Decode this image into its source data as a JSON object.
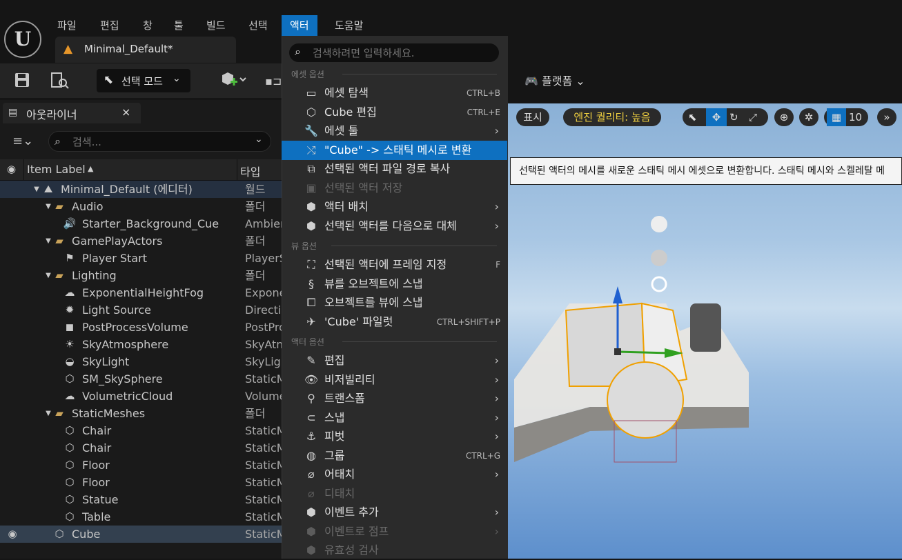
{
  "menubar": {
    "items": [
      "파일",
      "편집",
      "창",
      "툴",
      "빌드",
      "선택",
      "액터",
      "도움말"
    ],
    "active": "액터"
  },
  "logo_icon": "unreal-logo",
  "doc_tab": {
    "title": "Minimal_Default*"
  },
  "toolbar": {
    "mode_label": "선택 모드",
    "platform_label": "플랫폼"
  },
  "outliner": {
    "tab_title": "아웃라이너",
    "search_placeholder": "검색...",
    "col_label": "Item Label",
    "col_type": "타입",
    "rows": [
      {
        "label": "Minimal_Default (에디터)",
        "type": "월드",
        "icon": "world-icon",
        "indent": 1
      },
      {
        "label": "Audio",
        "type": "폴더",
        "icon": "folder-icon",
        "indent": 2
      },
      {
        "label": "Starter_Background_Cue",
        "type": "Ambien",
        "icon": "speaker-icon",
        "indent": 3
      },
      {
        "label": "GamePlayActors",
        "type": "폴더",
        "icon": "folder-icon",
        "indent": 2
      },
      {
        "label": "Player Start",
        "type": "PlayerS",
        "icon": "player-start-icon",
        "indent": 3
      },
      {
        "label": "Lighting",
        "type": "폴더",
        "icon": "folder-icon",
        "indent": 2
      },
      {
        "label": "ExponentialHeightFog",
        "type": "Expone",
        "icon": "fog-icon",
        "indent": 3
      },
      {
        "label": "Light Source",
        "type": "Directio",
        "icon": "light-icon",
        "indent": 3
      },
      {
        "label": "PostProcessVolume",
        "type": "PostPro",
        "icon": "volume-icon",
        "indent": 3
      },
      {
        "label": "SkyAtmosphere",
        "type": "SkyAtm",
        "icon": "atmosphere-icon",
        "indent": 3
      },
      {
        "label": "SkyLight",
        "type": "SkyLig",
        "icon": "skylight-icon",
        "indent": 3
      },
      {
        "label": "SM_SkySphere",
        "type": "StaticM",
        "icon": "mesh-icon",
        "indent": 3
      },
      {
        "label": "VolumetricCloud",
        "type": "Volume",
        "icon": "cloud-icon",
        "indent": 3
      },
      {
        "label": "StaticMeshes",
        "type": "폴더",
        "icon": "folder-icon",
        "indent": 2
      },
      {
        "label": "Chair",
        "type": "StaticM",
        "icon": "mesh-icon",
        "indent": 3
      },
      {
        "label": "Chair",
        "type": "StaticM",
        "icon": "mesh-icon",
        "indent": 3
      },
      {
        "label": "Floor",
        "type": "StaticM",
        "icon": "mesh-icon",
        "indent": 3
      },
      {
        "label": "Floor",
        "type": "StaticM",
        "icon": "mesh-icon",
        "indent": 3
      },
      {
        "label": "Statue",
        "type": "StaticM",
        "icon": "mesh-icon",
        "indent": 3
      },
      {
        "label": "Table",
        "type": "StaticM",
        "icon": "mesh-icon",
        "indent": 3
      },
      {
        "label": "Cube",
        "type": "StaticM",
        "icon": "mesh-icon",
        "indent": 2
      }
    ]
  },
  "dropdown": {
    "search_placeholder": "검색하려면 입력하세요.",
    "sections": {
      "asset": "에셋 옵션",
      "view": "뷰 옵션",
      "actor": "액터 옵션"
    },
    "items": [
      {
        "label": "에셋 탐색",
        "shortcut": "CTRL+B",
        "icon": "browse-icon"
      },
      {
        "label": "Cube 편집",
        "shortcut": "CTRL+E",
        "icon": "mesh-icon"
      },
      {
        "label": "에셋 툴",
        "shortcut": "",
        "icon": "wrench-icon",
        "submenu": true
      },
      {
        "label": "\"Cube\" -> 스태틱 메시로 변환",
        "shortcut": "",
        "icon": "convert-icon",
        "active": true
      },
      {
        "label": "선택된 액터 파일 경로 복사",
        "shortcut": "",
        "icon": "copy-icon"
      },
      {
        "label": "선택된 액터 저장",
        "shortcut": "",
        "icon": "save-icon",
        "disabled": true
      },
      {
        "label": "액터 배치",
        "shortcut": "",
        "icon": "place-actor-icon",
        "submenu": true
      },
      {
        "label": "선택된 액터를 다음으로 대체",
        "shortcut": "",
        "icon": "replace-icon",
        "submenu": true
      },
      {
        "label": "선택된 액터에 프레임 지정",
        "shortcut": "F",
        "icon": "frame-icon"
      },
      {
        "label": "뷰를 오브젝트에 스냅",
        "shortcut": "",
        "icon": "snap-view-icon"
      },
      {
        "label": "오브젝트를 뷰에 스냅",
        "shortcut": "",
        "icon": "snap-object-icon"
      },
      {
        "label": "'Cube' 파일럿",
        "shortcut": "CTRL+SHIFT+P",
        "icon": "pilot-icon"
      },
      {
        "label": "편집",
        "shortcut": "",
        "icon": "pencil-icon",
        "submenu": true
      },
      {
        "label": "비저빌리티",
        "shortcut": "",
        "icon": "eye-icon",
        "submenu": true
      },
      {
        "label": "트랜스폼",
        "shortcut": "",
        "icon": "transform-icon",
        "submenu": true
      },
      {
        "label": "스냅",
        "shortcut": "",
        "icon": "magnet-icon",
        "submenu": true
      },
      {
        "label": "피벗",
        "shortcut": "",
        "icon": "pivot-icon",
        "submenu": true
      },
      {
        "label": "그룹",
        "shortcut": "CTRL+G",
        "icon": "group-icon"
      },
      {
        "label": "어태치",
        "shortcut": "",
        "icon": "attach-icon",
        "submenu": true
      },
      {
        "label": "디태치",
        "shortcut": "",
        "icon": "detach-icon",
        "disabled": true
      },
      {
        "label": "이벤트 추가",
        "shortcut": "",
        "icon": "event-icon",
        "submenu": true
      },
      {
        "label": "이벤트로 점프",
        "shortcut": "",
        "icon": "jump-icon",
        "disabled": true,
        "submenu": true
      },
      {
        "label": "유효성 검사",
        "shortcut": "",
        "icon": "validate-icon",
        "disabled": true
      }
    ]
  },
  "viewport": {
    "show_label": "표시",
    "quality_label": "엔진 퀄리티: 높음",
    "grid_value": "10",
    "tooltip": "선택된 액터의 메시를 새로운 스태틱 메시 에셋으로 변환합니다. 스태틱 메시와 스켈레탈 메"
  },
  "colors": {
    "accent": "#0e70c0",
    "quality_text": "#f0d040",
    "selection_outline": "#f0a000"
  }
}
